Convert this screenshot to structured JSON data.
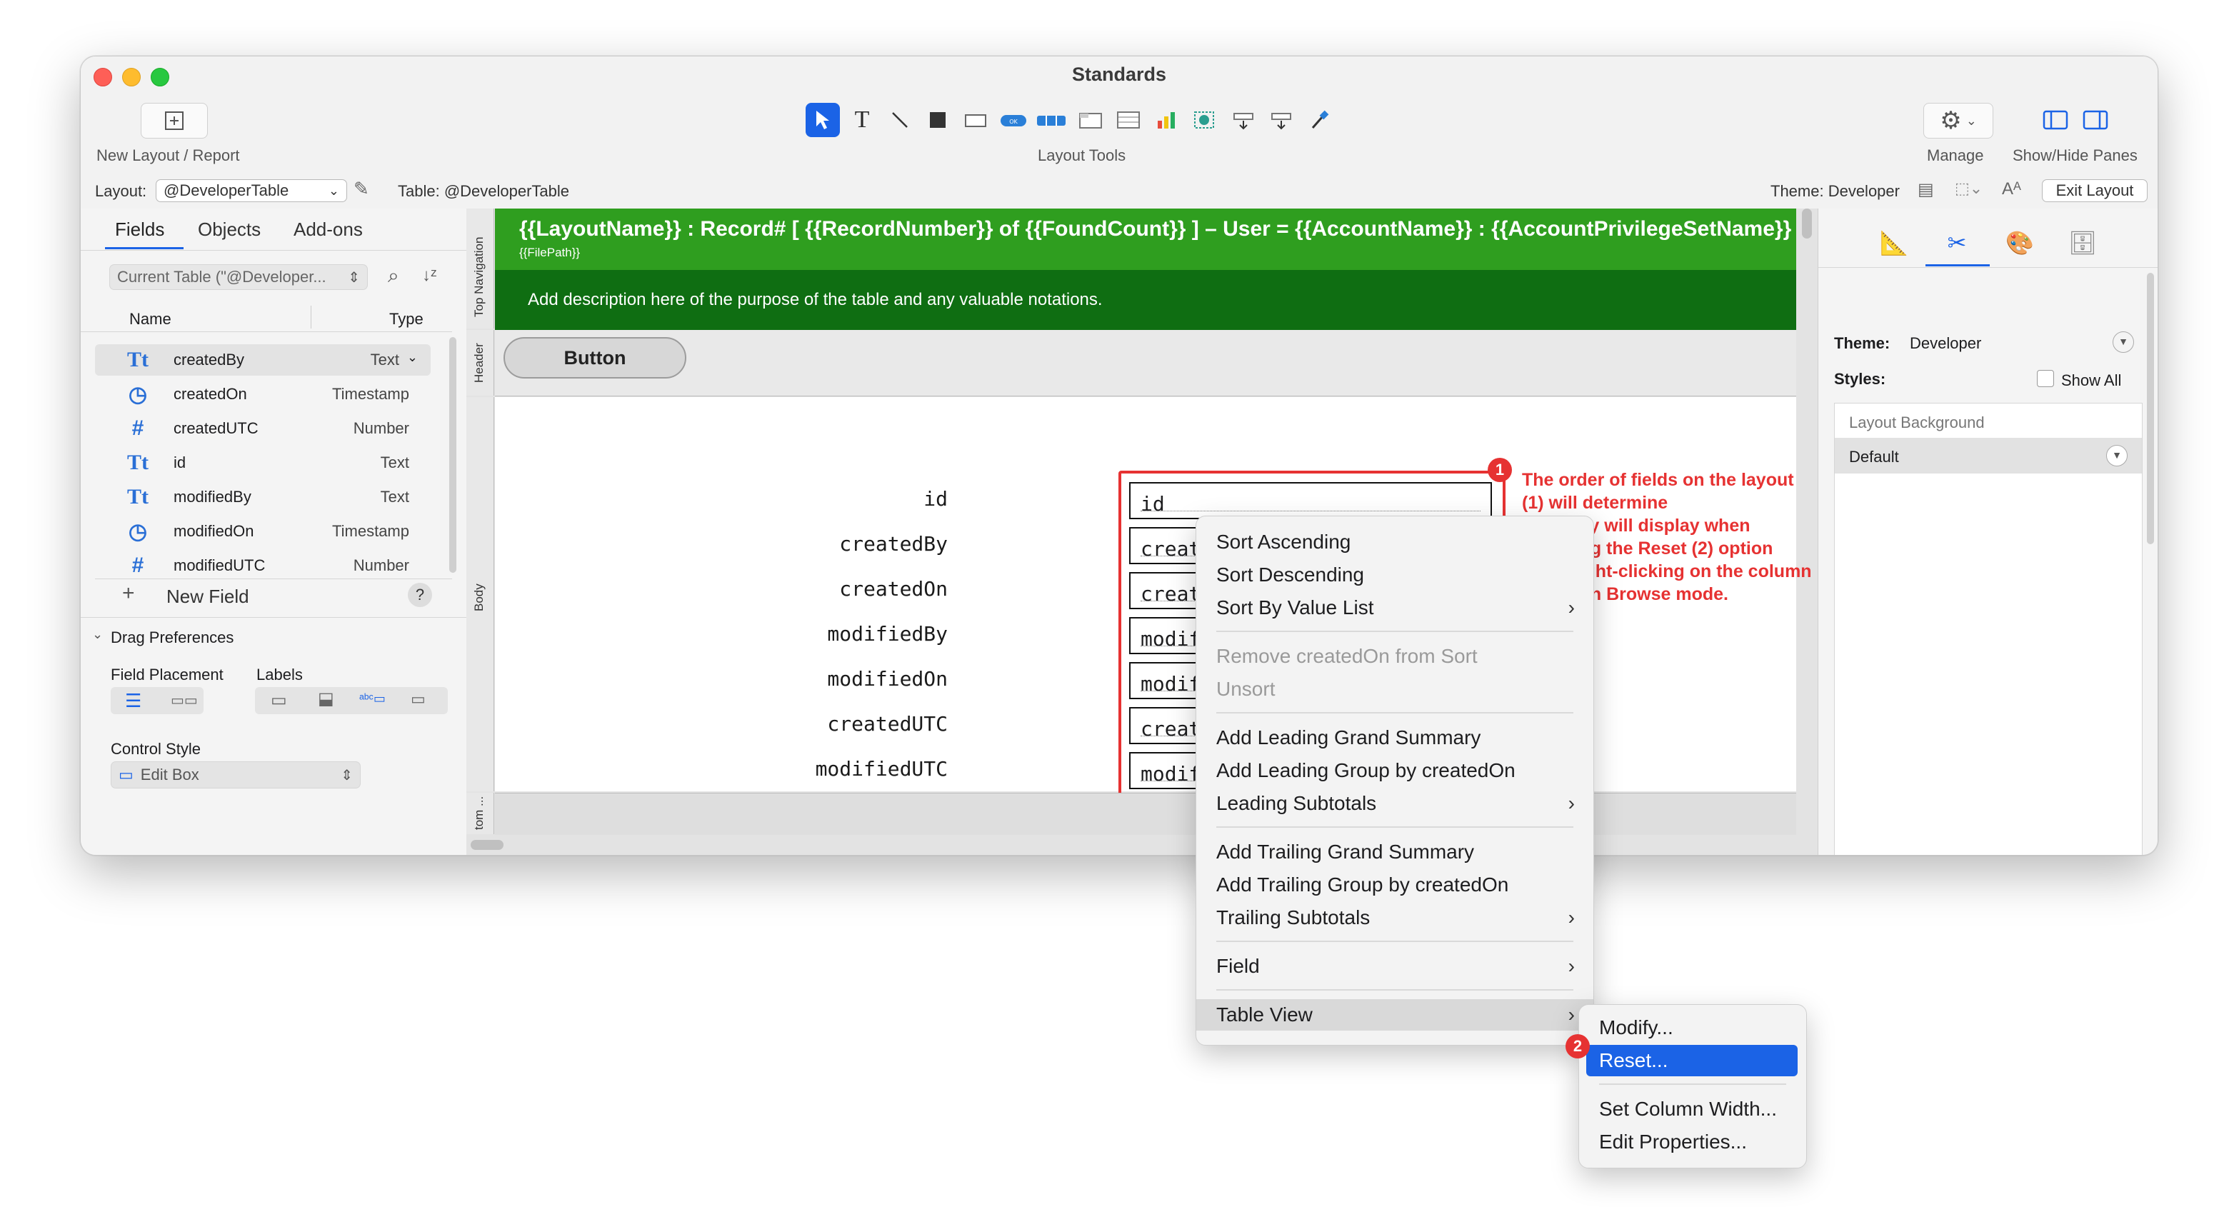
{
  "window": {
    "title": "Standards"
  },
  "toolbar": {
    "new_layout_label": "New Layout / Report",
    "layout_tools_label": "Layout Tools",
    "manage_label": "Manage",
    "show_hide_label": "Show/Hide Panes"
  },
  "infobar": {
    "layout_label": "Layout:",
    "layout_value": "@DeveloperTable",
    "table_label": "Table: @DeveloperTable",
    "theme_label": "Theme: Developer",
    "exit_layout": "Exit Layout"
  },
  "left_pane": {
    "tabs": [
      "Fields",
      "Objects",
      "Add-ons"
    ],
    "current_table": "Current Table (\"@Developer...",
    "col_name": "Name",
    "col_type": "Type",
    "fields": [
      {
        "icon": "text-field-icon",
        "glyph": "Tt",
        "name": "createdBy",
        "type": "Text"
      },
      {
        "icon": "timestamp-field-icon",
        "glyph": "◷",
        "name": "createdOn",
        "type": "Timestamp"
      },
      {
        "icon": "number-field-icon",
        "glyph": "#",
        "name": "createdUTC",
        "type": "Number"
      },
      {
        "icon": "text-field-icon",
        "glyph": "Tt",
        "name": "id",
        "type": "Text"
      },
      {
        "icon": "text-field-icon",
        "glyph": "Tt",
        "name": "modifiedBy",
        "type": "Text"
      },
      {
        "icon": "timestamp-field-icon",
        "glyph": "◷",
        "name": "modifiedOn",
        "type": "Timestamp"
      },
      {
        "icon": "number-field-icon",
        "glyph": "#",
        "name": "modifiedUTC",
        "type": "Number"
      }
    ],
    "new_field": "New Field",
    "help": "?",
    "drag_prefs": "Drag Preferences",
    "field_placement": "Field Placement",
    "labels": "Labels",
    "control_style": "Control Style",
    "control_style_value": "Edit Box"
  },
  "canvas": {
    "parts": [
      "Top Navigation",
      "Header",
      "Body",
      "tom ..."
    ],
    "header_title": "{{LayoutName}} : Record# [ {{RecordNumber}} of {{FoundCount}} ] – User = {{AccountName}} : {{AccountPrivilegeSetName}}",
    "header_filepath": "{{FilePath}}",
    "description": "Add description here of the purpose of the table and any valuable notations.",
    "button_label": "Button",
    "labels": [
      "id",
      "createdBy",
      "createdOn",
      "modifiedBy",
      "modifiedOn",
      "createdUTC",
      "modifiedUTC"
    ],
    "fields": [
      "id",
      "createdBy",
      "createdOn",
      "modifiedBy",
      "modifiedOn",
      "createdUTC",
      "modifiedUTC"
    ],
    "badge1": "1",
    "annotation": [
      "The order of fields on the layout (1) will determine",
      "how they will display when choosing the Reset (2) option",
      "when right-clicking on the column header in Browse mode."
    ]
  },
  "right_pane": {
    "theme_label": "Theme:",
    "theme_value": "Developer",
    "styles_label": "Styles:",
    "show_all": "Show All",
    "layout_background": "Layout Background",
    "default": "Default"
  },
  "context_menu": {
    "sort_ascending": "Sort Ascending",
    "sort_descending": "Sort Descending",
    "sort_by_value_list": "Sort By Value List",
    "remove_sort": "Remove createdOn from Sort",
    "unsort": "Unsort",
    "add_leading_grand": "Add Leading Grand Summary",
    "add_leading_group": "Add Leading Group by createdOn",
    "leading_subtotals": "Leading Subtotals",
    "add_trailing_grand": "Add Trailing Grand Summary",
    "add_trailing_group": "Add Trailing Group by createdOn",
    "trailing_subtotals": "Trailing Subtotals",
    "field": "Field",
    "table_view": "Table View",
    "arrow": "›"
  },
  "submenu": {
    "modify": "Modify...",
    "reset": "Reset...",
    "set_column_width": "Set Column Width...",
    "edit_properties": "Edit Properties...",
    "badge2": "2"
  },
  "colors": {
    "header_green": "#2f9e1f",
    "body_green": "#0f6e12",
    "accent_blue": "#1b63e6",
    "annotation_red": "#e63232"
  }
}
